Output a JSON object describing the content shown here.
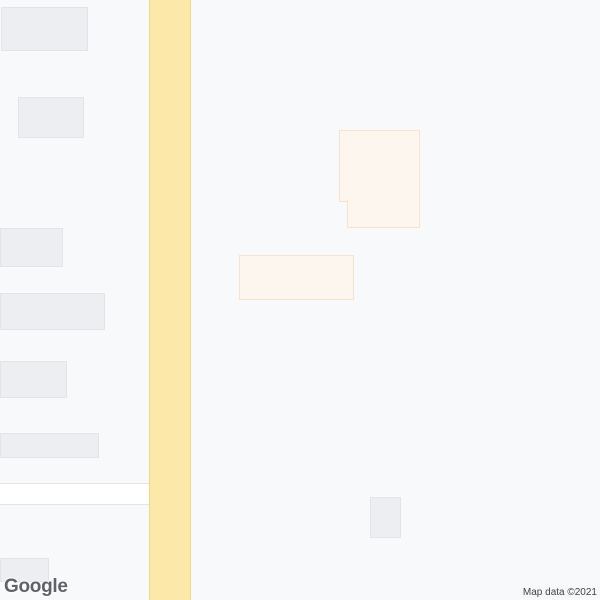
{
  "map": {
    "logo_text": "Google",
    "attribution": "Map data ©2021"
  },
  "colors": {
    "background": "#f8f9fb",
    "building": "#eceef2",
    "poi_building": "#fdf6ef",
    "main_road": "#fce8a8",
    "minor_road": "#ffffff"
  }
}
